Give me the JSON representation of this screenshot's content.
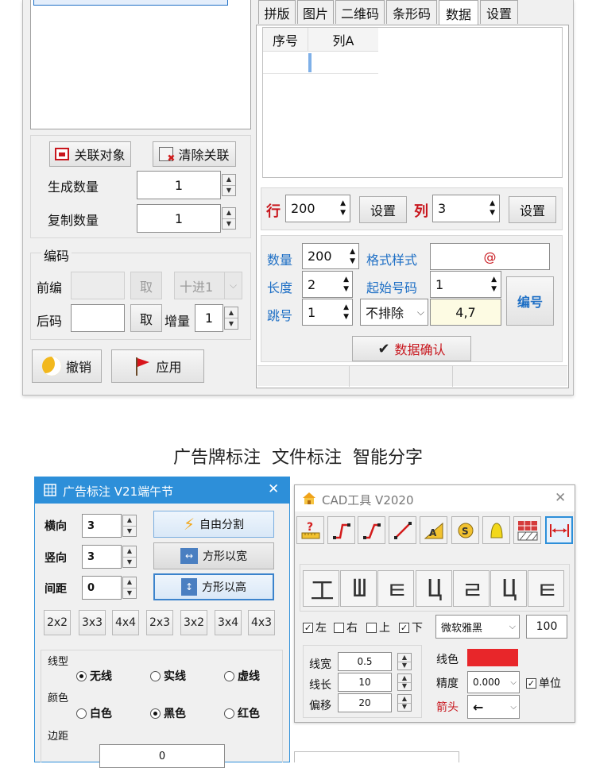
{
  "top_window": {
    "left": {
      "link_object_button": "关联对象",
      "clear_link_button": "清除关联",
      "generate_count_label": "生成数量",
      "generate_count_value": "1",
      "copy_count_label": "复制数量",
      "copy_count_value": "1",
      "coding_group_title": "编码",
      "prefix_label": "前编",
      "prefix_take_button": "取",
      "prefix_radix_value": "十进1",
      "suffix_label": "后码",
      "suffix_take_button": "取",
      "increment_label": "增量",
      "increment_value": "1",
      "undo_button": "撤销",
      "apply_button": "应用"
    },
    "tabs": [
      "拼版",
      "图片",
      "二维码",
      "条形码",
      "数据",
      "设置"
    ],
    "active_tab": "数据",
    "table": {
      "columns": [
        "序号",
        "列A"
      ]
    },
    "rows": {
      "row_label": "行",
      "row_value": "200",
      "row_set_button": "设置",
      "col_label": "列",
      "col_value": "3",
      "col_set_button": "设置"
    },
    "numbering": {
      "count_label": "数量",
      "count_value": "200",
      "format_label": "格式样式",
      "format_value": "@",
      "length_label": "长度",
      "length_value": "2",
      "start_label": "起始号码",
      "start_value": "1",
      "skip_label": "跳号",
      "skip_value": "1",
      "exclude_value": "不排除",
      "exclude_digits": "4,7",
      "number_button": "编号",
      "confirm_button": "数据确认"
    }
  },
  "caption": "广告牌标注  文件标注  智能分字",
  "ad_window": {
    "title": "广告标注 V21端午节",
    "close": "✕",
    "h_label": "横向",
    "h_value": "3",
    "v_label": "竖向",
    "v_value": "3",
    "gap_label": "间距",
    "gap_value": "0",
    "free_split_button": "自由分割",
    "square_width_button": "方形以宽",
    "square_height_button": "方形以高",
    "presets": [
      "2x2",
      "3x3",
      "4x4",
      "2x3",
      "3x2",
      "3x4",
      "4x3"
    ],
    "line_type_title": "线型",
    "line_types": [
      "无线",
      "实线",
      "虚线"
    ],
    "color_title": "颜色",
    "colors": [
      "白色",
      "黑色",
      "红色"
    ],
    "margin_title": "边距",
    "margin_value": "0"
  },
  "cad_window": {
    "title": "CAD工具 V2020",
    "close": "✕",
    "checks": [
      "左",
      "右",
      "上",
      "下"
    ],
    "font_value": "微软雅黑",
    "font_size_value": "100",
    "line_width_label": "线宽",
    "line_width_value": "0.5",
    "line_length_label": "线长",
    "line_length_value": "10",
    "offset_label": "偏移",
    "offset_value": "20",
    "line_color_label": "线色",
    "line_color": "#e8262a",
    "precision_label": "精度",
    "precision_value": "0.000",
    "unit_label": "单位",
    "arrow_label": "箭头",
    "arrow_value": "←"
  }
}
